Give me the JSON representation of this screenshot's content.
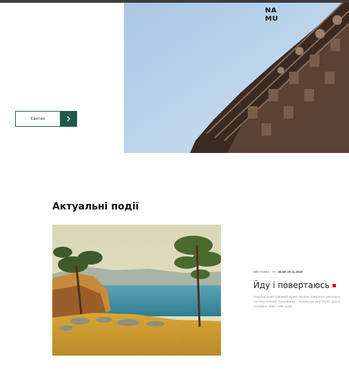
{
  "logo": {
    "line1": "NA",
    "line2": "MU"
  },
  "hero": {
    "tickets_label": "Квитки",
    "arrow_icon": "chevron-right-icon"
  },
  "events": {
    "heading": "Актуальні події",
    "items": [
      {
        "type": "ВИСТАВКА",
        "dates": "26.08–29.11.2019",
        "title": "Йду і повертаюсь",
        "description": "Національний художній музей України презентує унікальну частину колекції ГрадоБанку – українське мистецтво другої половини 1960–1990 років"
      }
    ]
  },
  "colors": {
    "accent": "#1d5a4a",
    "marker": "#d0021b"
  }
}
